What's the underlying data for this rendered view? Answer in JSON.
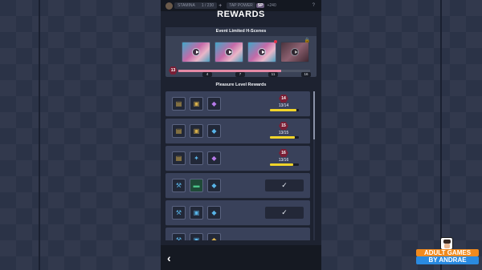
{
  "topbar": {
    "stamina_label": "STAMINA",
    "stamina_value": "1 / 230",
    "plus": "+",
    "tap_power_label": "TAP POWER",
    "sp_badge": "SP",
    "tap_power_value": "+240",
    "help": "?"
  },
  "title": "REWARDS",
  "event": {
    "heading": "Event Limited H-Scenes",
    "current_level": "13",
    "progress_fraction": 0.78,
    "milestones": [
      "4",
      "7",
      "11",
      "16"
    ]
  },
  "rewards": {
    "heading": "Pleasure Level Rewards",
    "rows": [
      {
        "state": "progress",
        "level": "14",
        "progress_text": "13/14",
        "progress_fraction": 0.93
      },
      {
        "state": "progress",
        "level": "15",
        "progress_text": "13/15",
        "progress_fraction": 0.87
      },
      {
        "state": "progress",
        "level": "16",
        "progress_text": "13/16",
        "progress_fraction": 0.81
      },
      {
        "state": "claimed",
        "check": "✓"
      },
      {
        "state": "claimed",
        "check": "✓"
      }
    ]
  },
  "nav": {
    "back": "‹"
  },
  "watermark": {
    "line1": "ADULT GAMES",
    "line2": "BY ANDRAE"
  },
  "colors": {
    "accent_pink": "#e48aa6",
    "progress_yellow": "#f0d42a",
    "level_badge": "#7a1f36",
    "row_bg": "#39415a"
  }
}
